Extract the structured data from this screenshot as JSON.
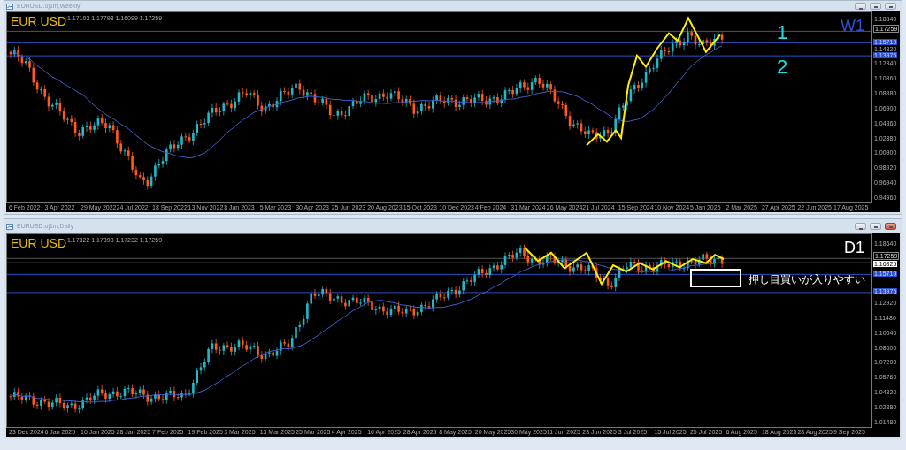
{
  "windows": [
    {
      "title": "EURUSD.oj1m,Weekly",
      "active": false,
      "symbol": "EUR USD",
      "ohlc": "1.17103 1.17798 1.16099 1.17259",
      "timeframe": "W1",
      "annotations": [
        {
          "kind": "number",
          "text": "1"
        },
        {
          "kind": "number",
          "text": "2"
        }
      ],
      "price_axis": [
        {
          "kind": "tick",
          "text": "1.18840"
        },
        {
          "kind": "current",
          "text": "1.17259"
        },
        {
          "kind": "level",
          "text": "1.15719"
        },
        {
          "kind": "tick",
          "text": "1.14820"
        },
        {
          "kind": "level",
          "text": "1.13975"
        },
        {
          "kind": "tick",
          "text": "1.12840"
        },
        {
          "kind": "tick",
          "text": "1.10860"
        },
        {
          "kind": "tick",
          "text": "1.08880"
        },
        {
          "kind": "tick",
          "text": "1.06900"
        },
        {
          "kind": "tick",
          "text": "1.04860"
        },
        {
          "kind": "tick",
          "text": "1.02880"
        },
        {
          "kind": "tick",
          "text": "1.00900"
        },
        {
          "kind": "tick",
          "text": "0.98920"
        },
        {
          "kind": "tick",
          "text": "0.96940"
        },
        {
          "kind": "tick",
          "text": "0.94960"
        }
      ],
      "date_axis": [
        "6 Feb 2022",
        "3 Apr 2022",
        "29 May 2022",
        "24 Jul 2022",
        "18 Sep 2022",
        "13 Nov 2022",
        "8 Jan 2023",
        "5 Mar 2023",
        "30 Apr 2023",
        "25 Jun 2023",
        "20 Aug 2023",
        "15 Oct 2023",
        "10 Dec 2023",
        "4 Feb 2024",
        "31 Mar 2024",
        "26 May 2024",
        "21 Jul 2024",
        "15 Sep 2024",
        "10 Nov 2024",
        "5 Jan 2025",
        "2 Mar 2025",
        "27 Apr 2025",
        "22 Jun 2025",
        "17 Aug 2025"
      ]
    },
    {
      "title": "EURUSD.oj1m,Daily",
      "active": true,
      "symbol": "EUR USD",
      "ohlc": "1.17322 1.17398 1.17232 1.17259",
      "timeframe": "D1",
      "annotations": [
        {
          "kind": "callout",
          "text": "押し目買いが入りやすい"
        }
      ],
      "price_axis": [
        {
          "kind": "tick",
          "text": "1.18640"
        },
        {
          "kind": "current",
          "text": "1.17259"
        },
        {
          "kind": "marker",
          "text": "1.16825"
        },
        {
          "kind": "level",
          "text": "1.15719"
        },
        {
          "kind": "level",
          "text": "1.13975"
        },
        {
          "kind": "tick",
          "text": "1.12920"
        },
        {
          "kind": "tick",
          "text": "1.11480"
        },
        {
          "kind": "tick",
          "text": "1.10040"
        },
        {
          "kind": "tick",
          "text": "1.08600"
        },
        {
          "kind": "tick",
          "text": "1.07200"
        },
        {
          "kind": "tick",
          "text": "1.05760"
        },
        {
          "kind": "tick",
          "text": "1.04320"
        },
        {
          "kind": "tick",
          "text": "1.02880"
        },
        {
          "kind": "tick",
          "text": "1.01480"
        }
      ],
      "date_axis": [
        "23 Dec 2024",
        "6 Jan 2025",
        "16 Jan 2025",
        "28 Jan 2025",
        "7 Feb 2025",
        "19 Feb 2025",
        "3 Mar 2025",
        "13 Mar 2025",
        "25 Mar 2025",
        "4 Apr 2025",
        "16 Apr 2025",
        "28 Apr 2025",
        "8 May 2025",
        "20 May 2025",
        "30 May 2025",
        "11 Jun 2025",
        "23 Jun 2025",
        "3 Jul 2025",
        "15 Jul 2025",
        "25 Jul 2025",
        "6 Aug 2025",
        "18 Aug 2025",
        "28 Aug 2025",
        "9 Sep 2025"
      ]
    }
  ]
}
